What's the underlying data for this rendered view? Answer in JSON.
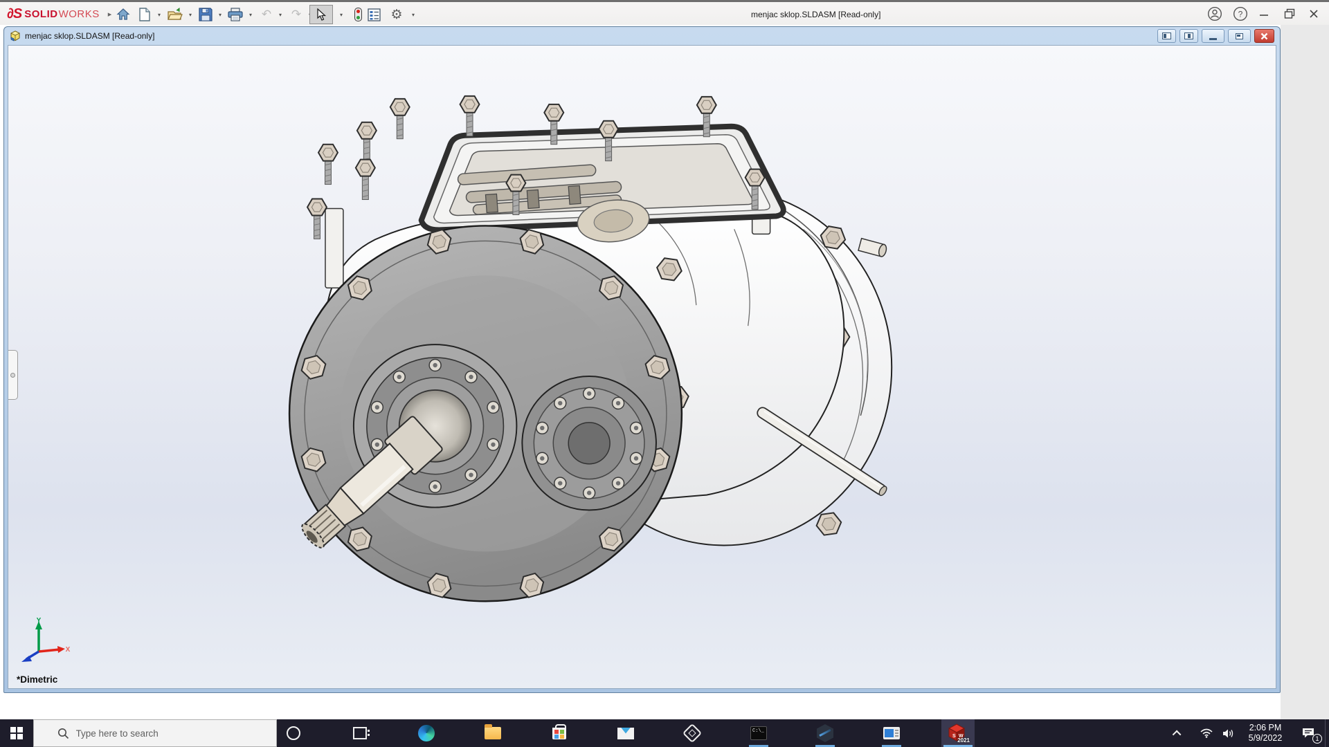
{
  "app": {
    "brand": {
      "mark": "∂S",
      "solid": "SOLID",
      "works": "WORKS",
      "flyout_glyph": "▸",
      "color": "#C8102E"
    },
    "title": "menjac sklop.SLDASM [Read-only]",
    "toolbar": {
      "items": [
        "home",
        "new",
        "open",
        "save",
        "print",
        "undo",
        "redo",
        "select",
        "rebuild",
        "file-properties",
        "options"
      ],
      "glyphs": {
        "dropdown": "▾",
        "undo": "↶",
        "redo": "↷",
        "gear": "⚙",
        "help": "?"
      }
    },
    "window_controls": [
      "account",
      "help",
      "minimize",
      "restore",
      "close"
    ]
  },
  "document": {
    "title": "menjac sklop.SLDASM [Read-only]",
    "view_label": "*Dimetric",
    "controls": [
      "pane-left",
      "pane-right",
      "minimize",
      "restore",
      "close"
    ],
    "triad": {
      "x_label": "X",
      "y_label": "Y",
      "x_color": "#E1251B",
      "y_color": "#009B48",
      "z_color": "#1A3FC4"
    }
  },
  "viewport": {
    "bg_top": "#F7F8FB",
    "bg_mid": "#DDE2EE",
    "bg_bottom": "#E9EDF4"
  },
  "model": {
    "kind": "gearbox assembly, shaded-with-edges",
    "body_color": "#FAFAFB",
    "edge_color": "#1F1F1F",
    "flange_color": "#9C9C9C",
    "cover_color": "#8F8F8F",
    "bolt_color": "#DDD3C7",
    "gasket_color": "#2F2F2F"
  },
  "taskbar": {
    "search": {
      "placeholder": "Type here to search"
    },
    "icons": [
      "start",
      "cortana",
      "task-view",
      "edge",
      "file-explorer",
      "store",
      "mail",
      "3d-viewer",
      "terminal",
      "hexagon-app",
      "media-app",
      "solidworks-2021"
    ],
    "running": [
      "terminal",
      "hexagon-app",
      "media-app",
      "solidworks-2021"
    ],
    "active": "solidworks-2021",
    "cmd_glyph": "C:\\_",
    "sw": {
      "s": "S",
      "w": "W",
      "year": "2021"
    },
    "tray": {
      "time": "2:06 PM",
      "date": "5/9/2022",
      "badge": "1"
    }
  }
}
